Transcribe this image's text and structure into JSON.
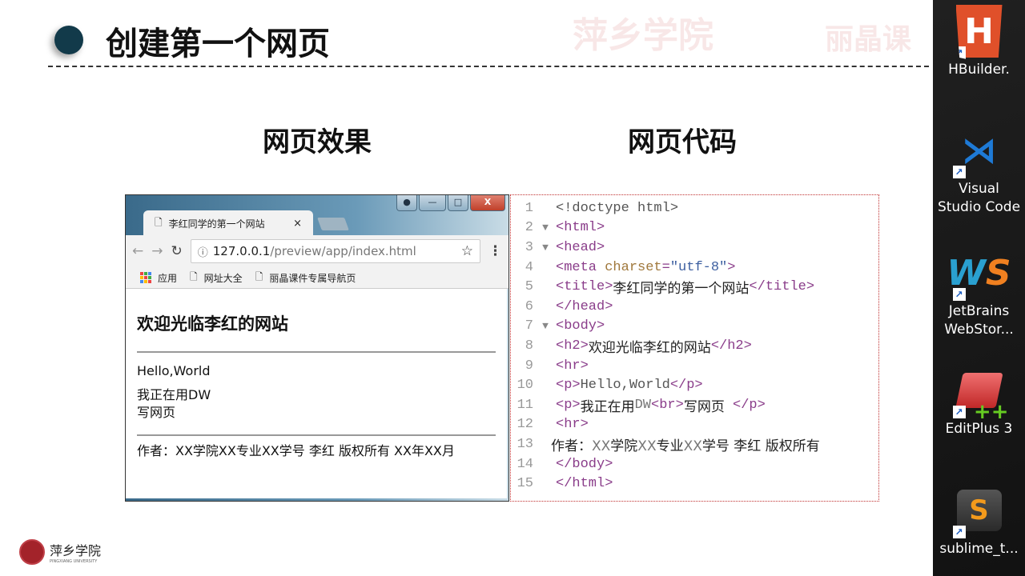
{
  "slide": {
    "title": "创建第一个网页",
    "left_heading": "网页效果",
    "right_heading": "网页代码",
    "watermark": [
      "萍乡学院",
      "丽晶课"
    ],
    "logo_text": "萍乡学院",
    "logo_subtext": "PINGXIANG UNIVERSITY"
  },
  "browser": {
    "tab_title": "李红同学的第一个网站",
    "tab_close": "×",
    "url_host": "127.0.0.1",
    "url_path": "/preview/app/index.html",
    "bookmarks": [
      "应用",
      "网址大全",
      "丽晶课件专属导航页"
    ],
    "page": {
      "heading": "欢迎光临李红的网站",
      "p1": "Hello,World",
      "p2_line1": "我正在用DW",
      "p2_line2": "写网页",
      "footer": "作者：XX学院XX专业XX学号 李红 版权所有 XX年XX月"
    }
  },
  "code": {
    "lines": [
      "1",
      "2",
      "3",
      "4",
      "5",
      "6",
      "7",
      "8",
      "9",
      "10",
      "11",
      "12",
      "13",
      "14",
      "15"
    ]
  },
  "colors": {
    "tag": "#8a3d8a",
    "attr": "#a0783c",
    "value": "#3d5fa0",
    "title_dot": "#123a4a"
  },
  "dock": [
    {
      "label1": "HBuilder.",
      "label2": ""
    },
    {
      "label1": "Visual",
      "label2": "Studio Code"
    },
    {
      "label1": "JetBrains",
      "label2": "WebStor..."
    },
    {
      "label1": "EditPlus 3",
      "label2": ""
    },
    {
      "label1": "sublime_t...",
      "label2": ""
    }
  ]
}
